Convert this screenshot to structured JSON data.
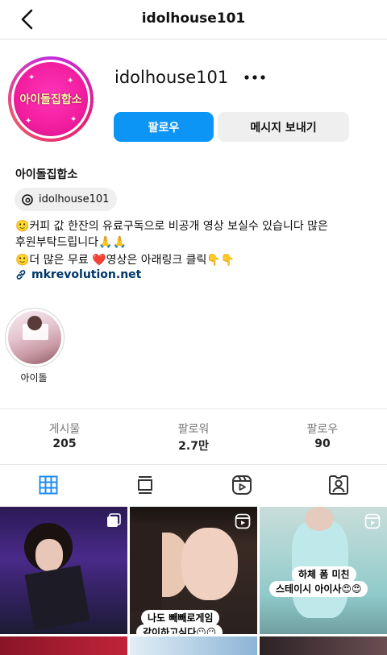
{
  "header": {
    "title": "idolhouse101"
  },
  "profile": {
    "username": "idolhouse101",
    "avatar_text": "아이돌집합소",
    "display_name": "아이돌집합소",
    "follow_label": "팔로우",
    "message_label": "메시지 보내기",
    "threads_handle": "idolhouse101",
    "bio_line1": "🙂커피 값 한잔의 유료구독으로 비공개 영상 보실수 있습니다 많은",
    "bio_line2": "후원부탁드립니다🙏🙏",
    "bio_line3": "🙂더 많은 무료 ❤️영상은 아래링크 클릭👇👇",
    "link": "mkrevolution.net"
  },
  "highlights": [
    {
      "label": "아이돌"
    }
  ],
  "stats": [
    {
      "label": "게시물",
      "value": "205"
    },
    {
      "label": "팔로워",
      "value": "2.7만"
    },
    {
      "label": "팔로우",
      "value": "90"
    }
  ],
  "tabs": [
    "grid-icon",
    "feed-icon",
    "reels-icon",
    "tagged-icon"
  ],
  "posts": [
    {
      "caption": ""
    },
    {
      "caption1": "나도 빼빼로게임",
      "caption2": "같이하고싶다😶😶"
    },
    {
      "caption1": "하체 폼 미친",
      "caption2": "스테이시 아이사😍😍"
    }
  ],
  "colors": {
    "accent": "#0d95f6",
    "link": "#00376b",
    "button_gray": "#efefef"
  }
}
